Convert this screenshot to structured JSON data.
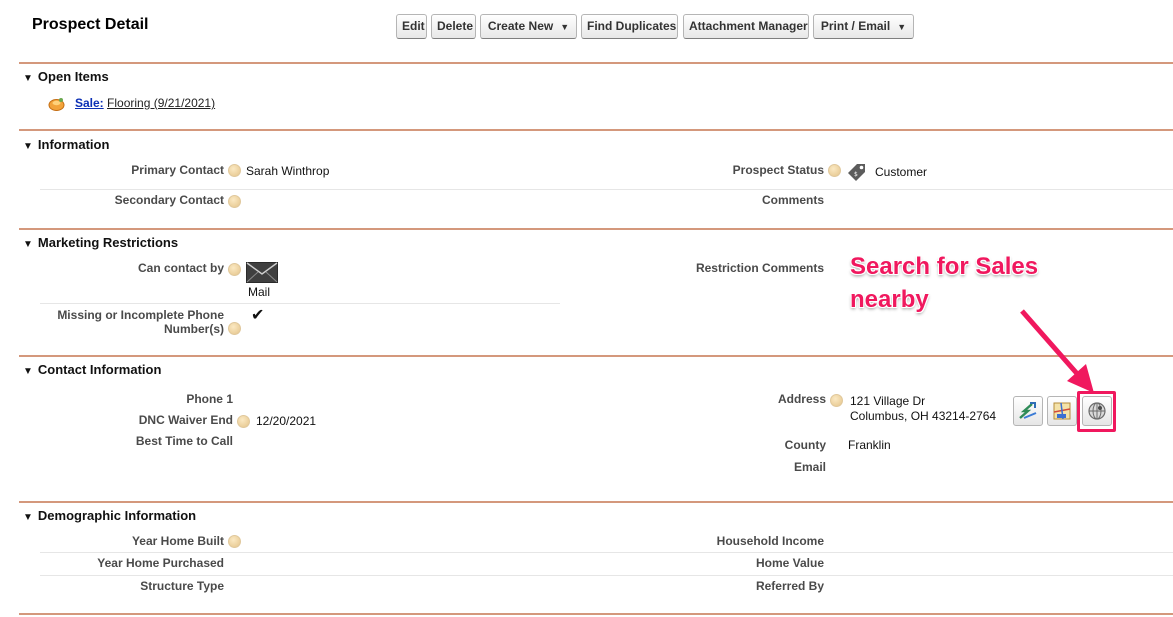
{
  "header": {
    "title": "Prospect Detail",
    "buttons": {
      "edit": "Edit",
      "delete": "Delete",
      "create_new": "Create New",
      "find_duplicates": "Find Duplicates",
      "attachment_manager": "Attachment Manager",
      "print_email": "Print / Email"
    }
  },
  "open_items": {
    "title": "Open Items",
    "item": {
      "type_label": "Sale:",
      "text": "Flooring (9/21/2021)"
    }
  },
  "information": {
    "title": "Information",
    "primary_contact_label": "Primary Contact",
    "primary_contact_value": "Sarah Winthrop",
    "secondary_contact_label": "Secondary Contact",
    "prospect_status_label": "Prospect Status",
    "prospect_status_value": "Customer",
    "comments_label": "Comments"
  },
  "marketing": {
    "title": "Marketing Restrictions",
    "can_contact_label": "Can contact by",
    "can_contact_value": "Mail",
    "missing_phone_label_line1": "Missing or Incomplete Phone",
    "missing_phone_label_line2": "Number(s)",
    "missing_phone_checked": true,
    "restriction_comments_label": "Restriction Comments"
  },
  "contact": {
    "title": "Contact Information",
    "phone1_label": "Phone 1",
    "dnc_label": "DNC Waiver End",
    "dnc_value": "12/20/2021",
    "best_time_label": "Best Time to Call",
    "address_label": "Address",
    "address_line1": "121 Village Dr",
    "address_line2": "Columbus, OH 43214-2764",
    "county_label": "County",
    "county_value": "Franklin",
    "email_label": "Email"
  },
  "demographic": {
    "title": "Demographic Information",
    "year_home_built_label": "Year Home Built",
    "year_home_purchased_label": "Year Home Purchased",
    "structure_type_label": "Structure Type",
    "household_income_label": "Household Income",
    "home_value_label": "Home Value",
    "referred_by_label": "Referred By"
  },
  "annotation": {
    "text": "Search for Sales nearby",
    "color": "#f0185e"
  },
  "icons": {
    "help": "help-icon",
    "sale": "sale-icon",
    "tag": "tag-icon",
    "mail": "mail-icon",
    "check": "checkmark-icon",
    "directions": "directions-icon",
    "map": "map-icon",
    "nearby": "nearby-search-icon"
  }
}
